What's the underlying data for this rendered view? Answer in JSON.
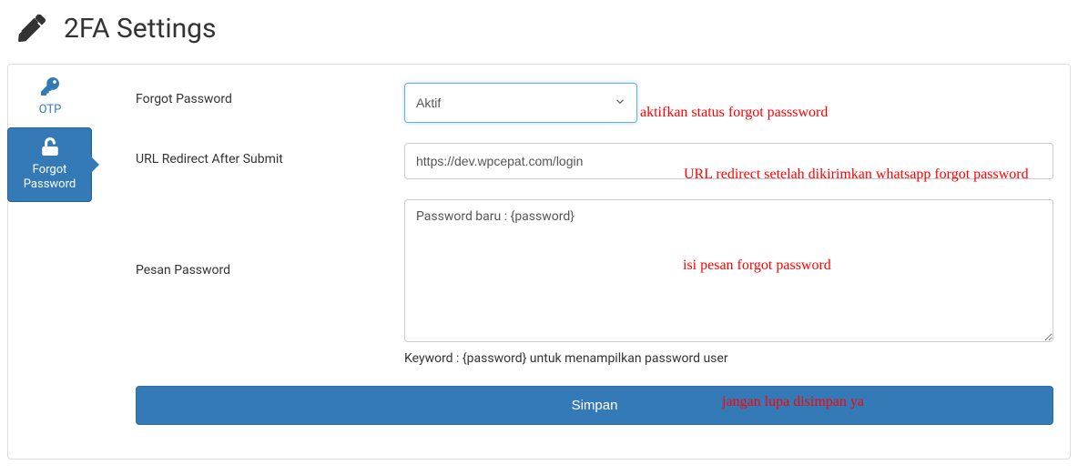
{
  "page": {
    "title": "2FA Settings"
  },
  "tabs": {
    "otp": {
      "label": "OTP"
    },
    "forgot": {
      "label": "Forgot Password"
    }
  },
  "form": {
    "forgot_password": {
      "label": "Forgot Password",
      "value": "Aktif"
    },
    "url_redirect": {
      "label": "URL Redirect After Submit",
      "value": "https://dev.wpcepat.com/login"
    },
    "pesan_password": {
      "label": "Pesan Password",
      "value": "Password baru : {password}",
      "help": "Keyword : {password} untuk menampilkan password user"
    },
    "submit_label": "Simpan"
  },
  "annotations": {
    "status": "aktifkan status forgot passsword",
    "redirect": "URL redirect setelah dikirimkan whatsapp forgot password",
    "pesan": "isi pesan forgot password",
    "save": "jangan lupa disimpan ya"
  }
}
